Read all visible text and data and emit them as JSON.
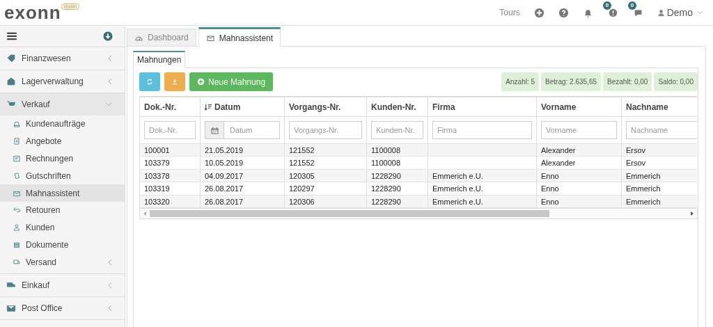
{
  "header": {
    "logo": "exonn",
    "logo_badge": "WaWi",
    "tours": "Tours",
    "alerts_badge": "0",
    "messages_badge": "0",
    "user": "Demo"
  },
  "sidebar": {
    "sections": [
      {
        "label": "Finanzwesen",
        "expanded": false
      },
      {
        "label": "Lagerverwaltung",
        "expanded": false
      },
      {
        "label": "Verkauf",
        "expanded": true,
        "children": [
          {
            "label": "Kundenaufträge",
            "selected": false,
            "has_submenu": false
          },
          {
            "label": "Angebote",
            "selected": false,
            "has_submenu": false
          },
          {
            "label": "Rechnungen",
            "selected": false,
            "has_submenu": false
          },
          {
            "label": "Gutschriften",
            "selected": false,
            "has_submenu": false
          },
          {
            "label": "Mahnassistent",
            "selected": true,
            "has_submenu": false
          },
          {
            "label": "Retouren",
            "selected": false,
            "has_submenu": false
          },
          {
            "label": "Kunden",
            "selected": false,
            "has_submenu": false
          },
          {
            "label": "Dokumente",
            "selected": false,
            "has_submenu": false
          },
          {
            "label": "Versand",
            "selected": false,
            "has_submenu": true
          }
        ]
      },
      {
        "label": "Einkauf",
        "expanded": false
      },
      {
        "label": "Post Office",
        "expanded": false
      }
    ]
  },
  "tabs": [
    {
      "label": "Dashboard",
      "selected": false
    },
    {
      "label": "Mahnassistent",
      "selected": true
    }
  ],
  "subtabs": [
    {
      "label": "Mahnungen",
      "selected": true
    }
  ],
  "toolbar": {
    "new_button": "Neue Mahnung",
    "summary": [
      "Anzahl: 5",
      "Betrag: 2.635,65",
      "Bezahlt: 0,00",
      "Saldo: 0,00"
    ]
  },
  "table": {
    "columns": [
      {
        "label": "Dok.-Nr.",
        "placeholder": "Dok.-Nr.",
        "sorted": false,
        "date": false
      },
      {
        "label": "Datum",
        "placeholder": "Datum",
        "sorted": true,
        "date": true
      },
      {
        "label": "Vorgangs-Nr.",
        "placeholder": "Vorgangs-Nr.",
        "sorted": false,
        "date": false
      },
      {
        "label": "Kunden-Nr.",
        "placeholder": "Kunden-Nr.",
        "sorted": false,
        "date": false
      },
      {
        "label": "Firma",
        "placeholder": "Firma",
        "sorted": false,
        "date": false
      },
      {
        "label": "Vorname",
        "placeholder": "Vorname",
        "sorted": false,
        "date": false
      },
      {
        "label": "Nachname",
        "placeholder": "Nachname",
        "sorted": false,
        "date": false
      }
    ],
    "rows": [
      [
        "100001",
        "21.05.2019",
        "121552",
        "1100008",
        "",
        "Alexander",
        "Ersov"
      ],
      [
        "103379",
        "10.05.2019",
        "121552",
        "1100008",
        "",
        "Alexander",
        "Ersov"
      ],
      [
        "103378",
        "04.09.2017",
        "120305",
        "1228290",
        "Emmerich e.U.",
        "Enno",
        "Emmerich"
      ],
      [
        "103319",
        "26.08.2017",
        "120297",
        "1228290",
        "Emmerich e.U.",
        "Enno",
        "Emmerich"
      ],
      [
        "103320",
        "26.08.2017",
        "120306",
        "1228290",
        "Emmerich e.U.",
        "Enno",
        "Emmerich"
      ]
    ]
  }
}
